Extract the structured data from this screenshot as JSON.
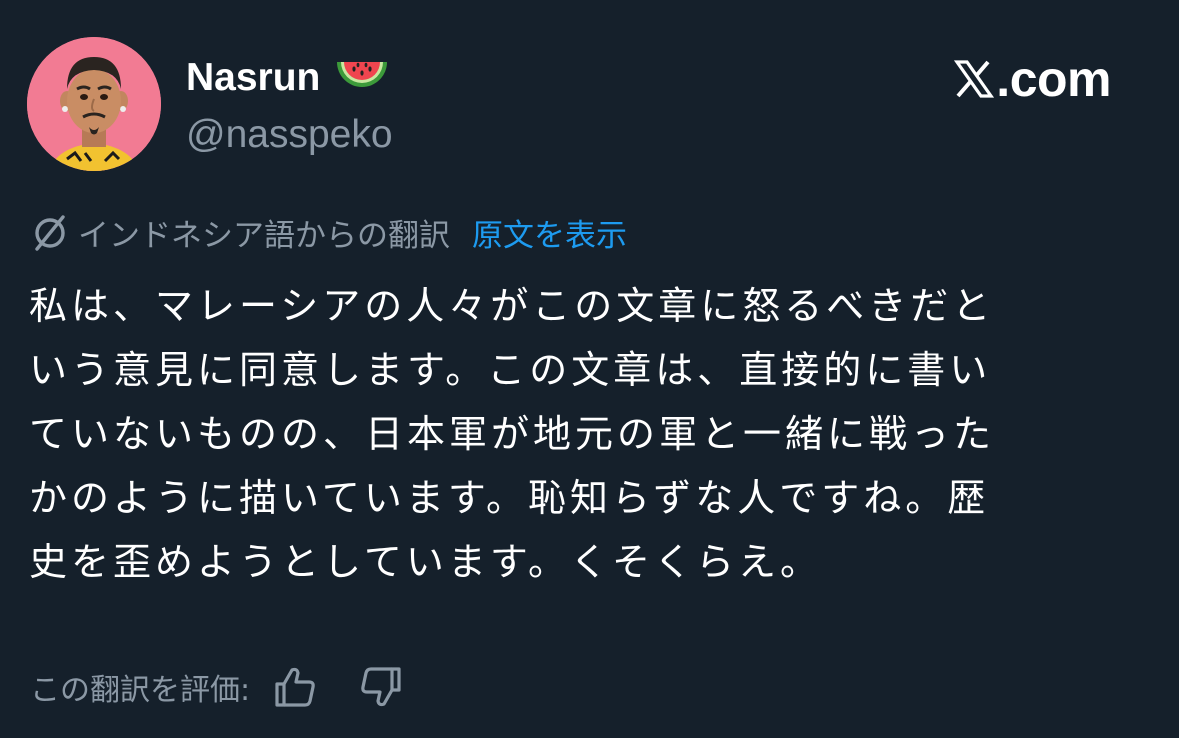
{
  "user": {
    "display_name": "Nasrun",
    "handle": "@nasspeko"
  },
  "brand": {
    "text": ".com"
  },
  "translation": {
    "label": "インドネシア語からの翻訳",
    "show_original": "原文を表示"
  },
  "tweet": {
    "lines": [
      "私は、マレーシアの人々がこの文章に怒るべきだと",
      "いう意見に同意します。この文章は、直接的に書い",
      "ていないものの、日本軍が地元の軍と一緒に戦った",
      "かのように描いています。恥知らずな人ですね。歴",
      "史を歪めようとしています。くそくらえ。"
    ]
  },
  "rating": {
    "label": "この翻訳を評価:"
  },
  "icons": {
    "avatar": "memoji-avatar",
    "emoji": "watermelon-icon",
    "logo": "x-logo-icon",
    "translate": "translate-icon",
    "thumbs_up": "thumbs-up-icon",
    "thumbs_down": "thumbs-down-icon"
  },
  "colors": {
    "background": "#15202b",
    "text": "#ffffff",
    "secondary_text": "#8b98a5",
    "link": "#1d9bf0",
    "avatar_bg": "#f27b93"
  }
}
